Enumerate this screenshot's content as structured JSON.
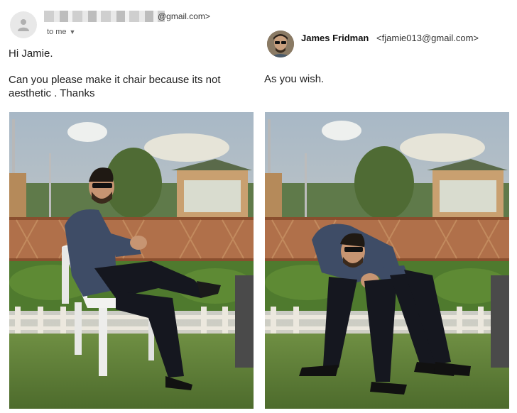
{
  "left_email": {
    "sender_domain": "@gmail.com>",
    "to_label": "to me",
    "greeting": "Hi Jamie.",
    "body": "Can you please make it chair because its not aesthetic . Thanks"
  },
  "right_email": {
    "sender_name": "James Fridman",
    "sender_email": "<fjamie013@gmail.com>",
    "reply": "As you wish."
  }
}
